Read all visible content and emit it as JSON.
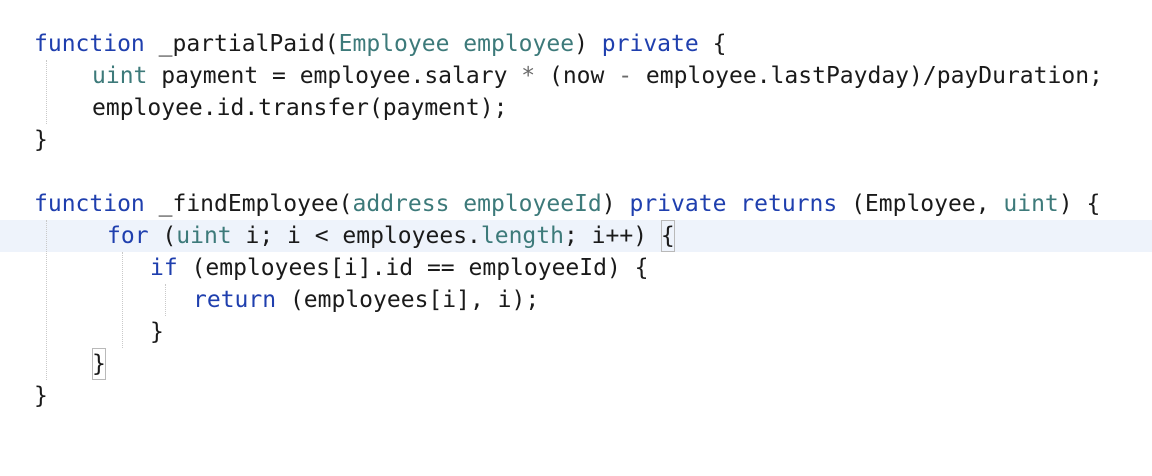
{
  "editor": {
    "language": "Solidity",
    "colors": {
      "keyword": "#1f3fae",
      "type": "#3d7a7a",
      "text": "#1a1a1a",
      "current_line": "#eef3fb",
      "indent_guide": "#c9c9c9"
    },
    "lines": [
      [
        "function",
        " _partialPaid(",
        "Employee",
        " ",
        "employee",
        ") ",
        "private",
        " {"
      ],
      [
        "uint",
        " payment = employee.salary ",
        "*",
        " (now ",
        "-",
        " employee.lastPayday)/payDuration;"
      ],
      [
        "employee.id.transfer(payment);"
      ],
      [
        "}"
      ],
      [
        ""
      ],
      [
        "function",
        " _findEmployee(",
        "address",
        " ",
        "employeeId",
        ") ",
        "private",
        " ",
        "returns",
        " (Employee, ",
        "uint",
        ") {"
      ],
      [
        "for",
        " (",
        "uint",
        " i; i < employees.",
        "length",
        "; i++) ",
        "{"
      ],
      [
        "if",
        " (employees[i].id == employeeId) {"
      ],
      [
        "return",
        " (employees[i], i);"
      ],
      [
        "}"
      ],
      [
        "}"
      ],
      [
        "}"
      ]
    ]
  }
}
